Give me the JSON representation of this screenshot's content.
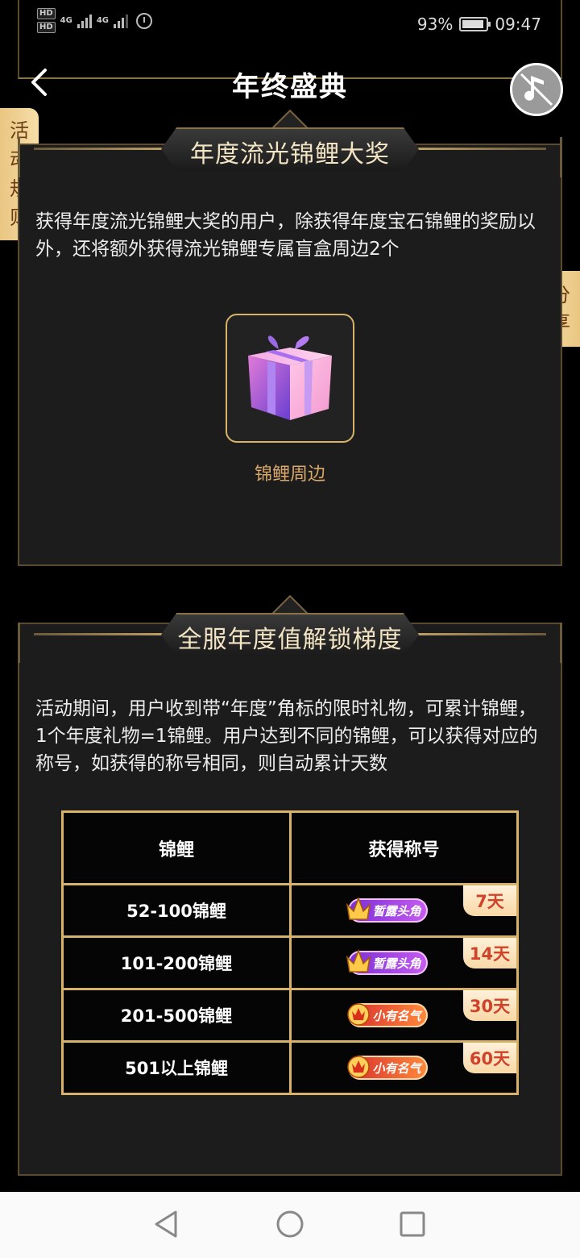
{
  "status_bar": {
    "hd1": "HD",
    "hd2": "HD",
    "net1": "4G",
    "net2": "4G",
    "battery": "93%",
    "battery_level": 0.93,
    "time": "09:47"
  },
  "header": {
    "title": "年终盛典"
  },
  "side_tabs": {
    "rules": [
      "活",
      "动",
      "规",
      "则"
    ],
    "share": [
      "分",
      "享"
    ]
  },
  "section1": {
    "title": "年度流光锦鲤大奖",
    "description": "获得年度流光锦鲤大奖的用户，除获得年度宝石锦鲤的奖励以外，还将额外获得流光锦鲤专属盲盒周边2个",
    "prize_label": "锦鲤周边"
  },
  "section2": {
    "title": "全服年度值解锁梯度",
    "description": "活动期间，用户收到带“年度”角标的限时礼物，可累计锦鲤， 1个年度礼物=1锦鲤。用户达到不同的锦鲤，可以获得对应的称号，如获得的称号相同，则自动累计天数",
    "table": {
      "headers": [
        "锦鲤",
        "获得称号"
      ],
      "rows": [
        {
          "range": "52-100锦鲤",
          "badge": "暂露头角",
          "days": "7天"
        },
        {
          "range": "101-200锦鲤",
          "badge": "暂露头角",
          "days": "14天"
        },
        {
          "range": "201-500锦鲤",
          "badge": "小有名气",
          "days": "30天"
        },
        {
          "range": "501以上锦鲤",
          "badge": "小有名气",
          "days": "60天"
        }
      ]
    }
  },
  "colors": {
    "gold": "#d9b26a",
    "panel_bg": "#1c1c1c",
    "tab_bg": "#f7dea8",
    "days_text": "#d0432a"
  }
}
